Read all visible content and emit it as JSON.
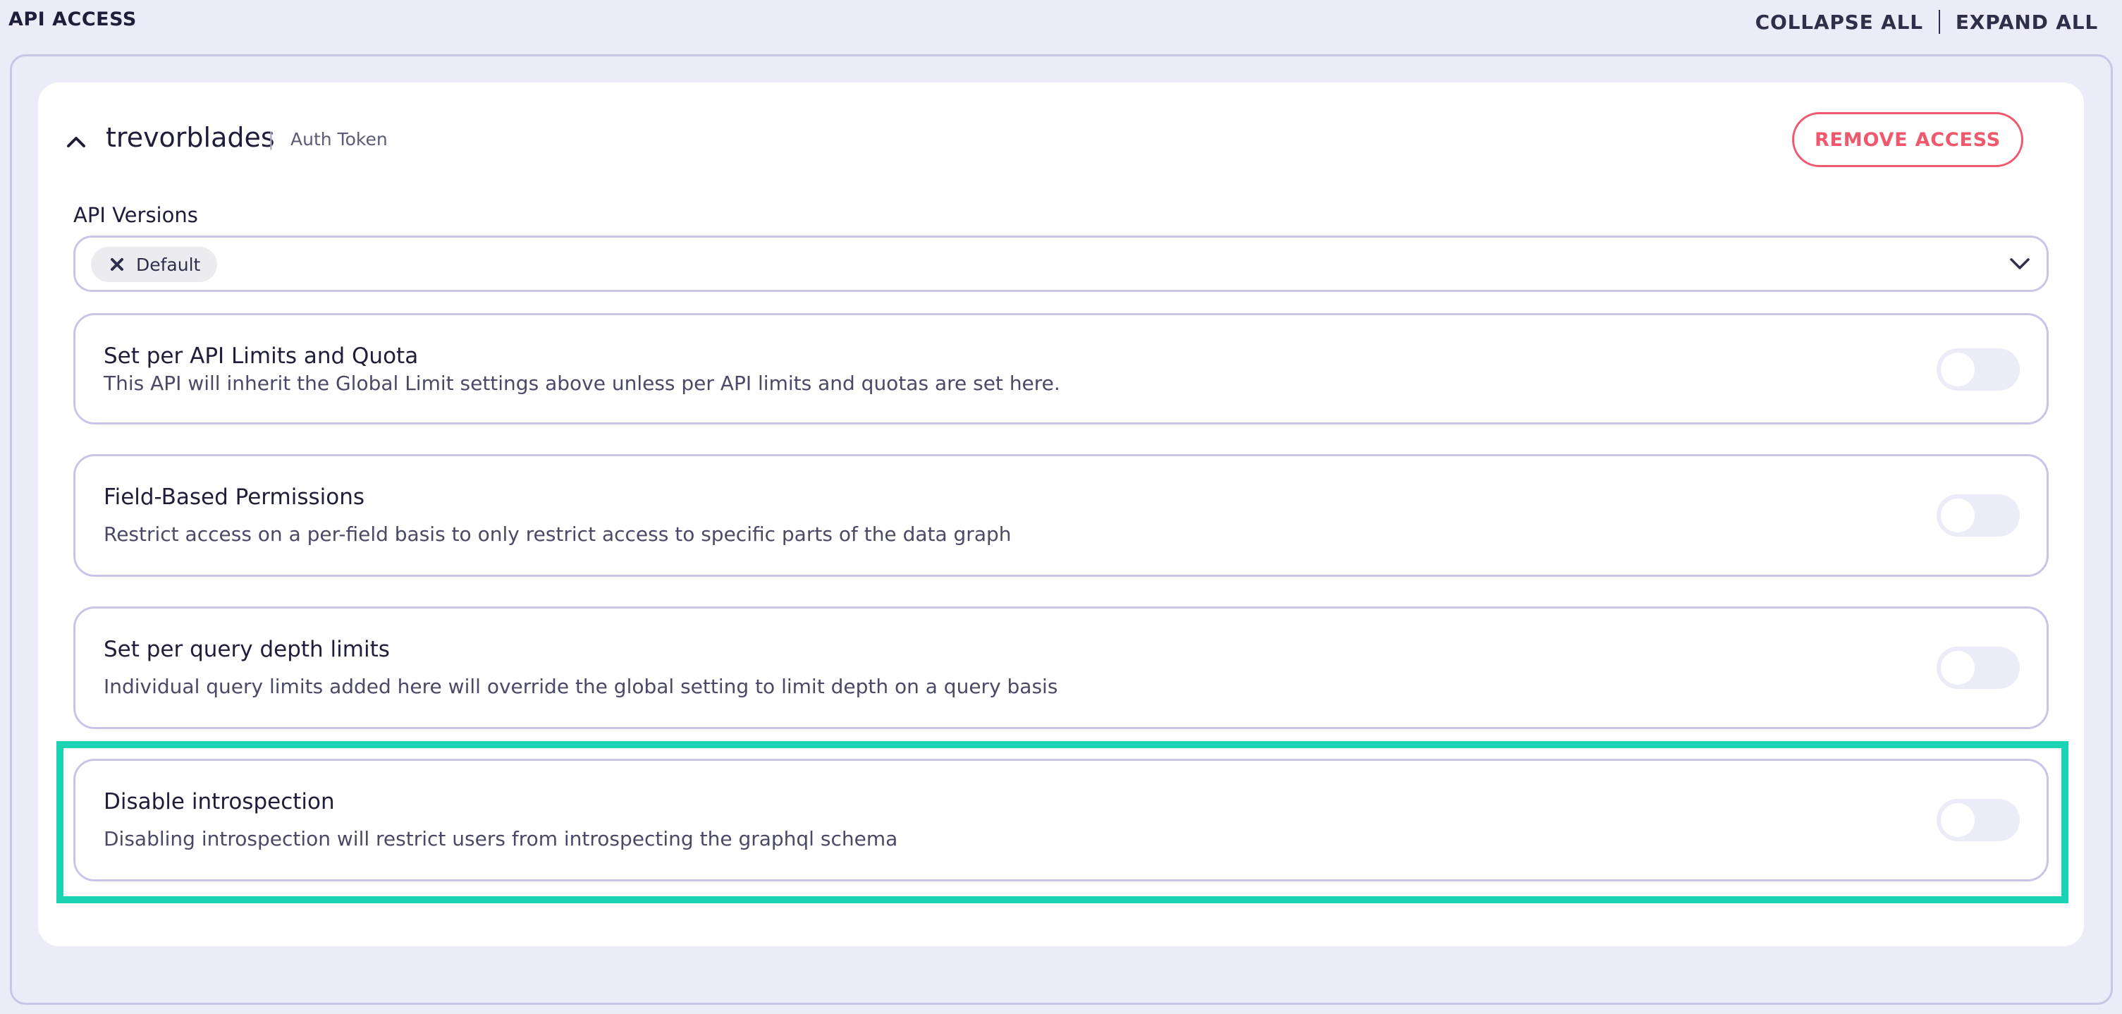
{
  "header": {
    "title": "API ACCESS",
    "collapse_all": "COLLAPSE ALL",
    "expand_all": "EXPAND ALL"
  },
  "access": {
    "name": "trevorblades",
    "separator": "|",
    "auth_type": "Auth Token",
    "remove_label": "REMOVE ACCESS",
    "versions_label": "API Versions",
    "selected_version": "Default"
  },
  "options": [
    {
      "title": "Set per API Limits and Quota",
      "description": "This API will inherit the Global Limit settings above unless per API limits and quotas are set here.",
      "enabled": false
    },
    {
      "title": "Field-Based Permissions",
      "description": "Restrict access on a per-field basis to only restrict access to specific parts of the data graph",
      "enabled": false
    },
    {
      "title": "Set per query depth limits",
      "description": "Individual query limits added here will override the global setting to limit depth on a query basis",
      "enabled": false
    },
    {
      "title": "Disable introspection",
      "description": "Disabling introspection will restrict users from introspecting the graphql schema",
      "enabled": false
    }
  ],
  "colors": {
    "accent_remove": "#f0586e",
    "highlight": "#1ad3b2",
    "border": "#c8c6e6",
    "background": "#ececf8"
  },
  "icons": {
    "collapse": "chevron-up-icon",
    "chip_remove": "close-icon",
    "select": "chevron-down-icon"
  }
}
